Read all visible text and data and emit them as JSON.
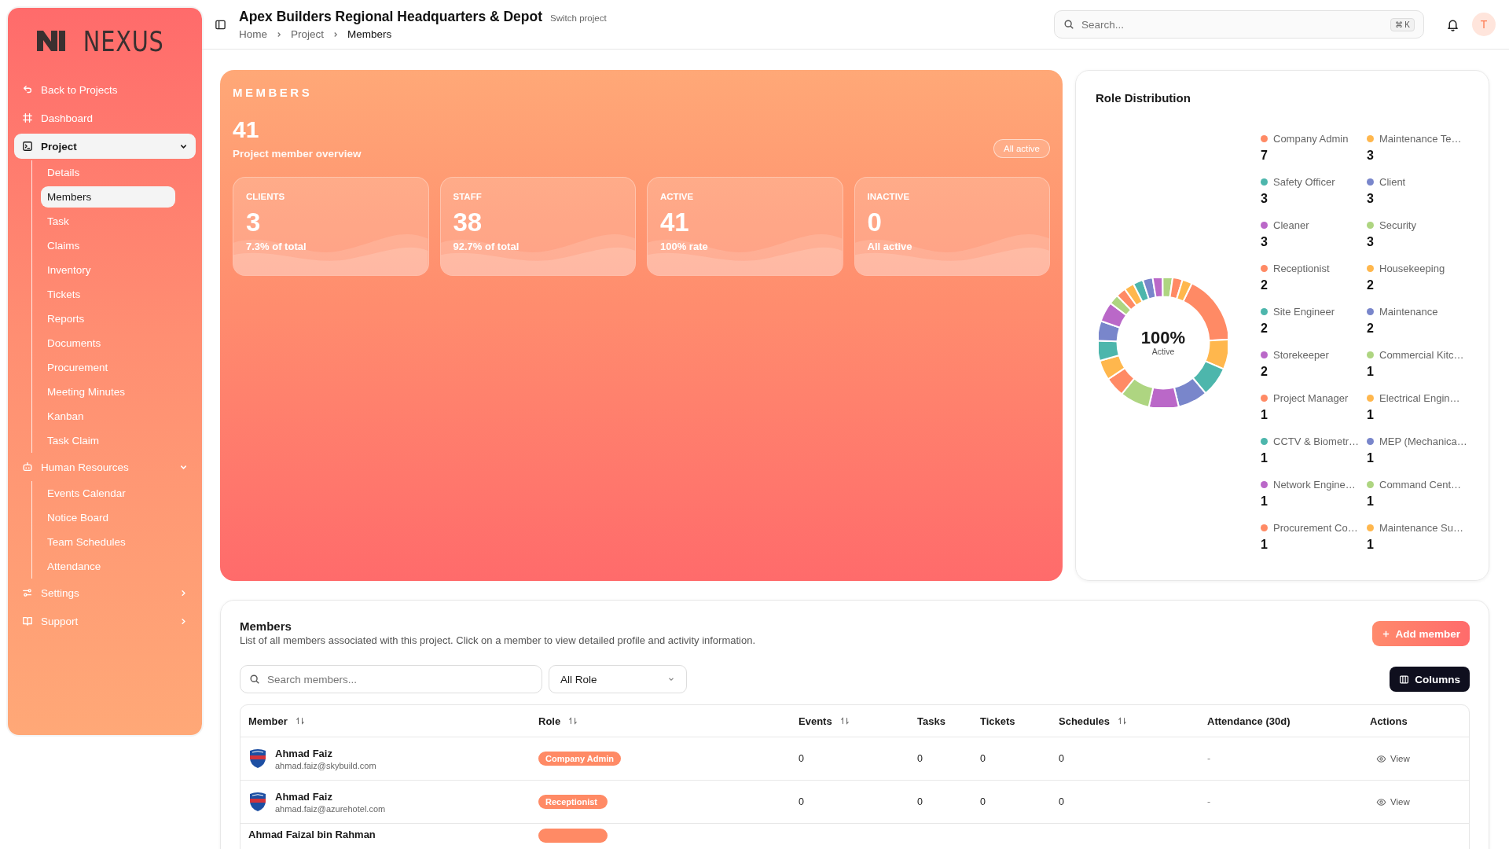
{
  "sidebar": {
    "logo": "NEXUS",
    "items": [
      {
        "label": "Back to Projects",
        "kind": "link",
        "selected": false
      },
      {
        "label": "Dashboard",
        "kind": "link",
        "selected": false
      },
      {
        "label": "Project",
        "kind": "group",
        "selected": true,
        "expanded": true,
        "children": [
          {
            "label": "Details",
            "selected": false
          },
          {
            "label": "Members",
            "selected": true
          },
          {
            "label": "Task",
            "selected": false
          },
          {
            "label": "Claims",
            "selected": false
          },
          {
            "label": "Inventory",
            "selected": false
          },
          {
            "label": "Tickets",
            "selected": false
          },
          {
            "label": "Reports",
            "selected": false
          },
          {
            "label": "Documents",
            "selected": false
          },
          {
            "label": "Procurement",
            "selected": false
          },
          {
            "label": "Meeting Minutes",
            "selected": false
          },
          {
            "label": "Kanban",
            "selected": false
          },
          {
            "label": "Task Claim",
            "selected": false
          }
        ]
      },
      {
        "label": "Human Resources",
        "kind": "group",
        "selected": false,
        "expanded": true,
        "children": [
          {
            "label": "Events Calendar",
            "selected": false
          },
          {
            "label": "Notice Board",
            "selected": false
          },
          {
            "label": "Team Schedules",
            "selected": false
          },
          {
            "label": "Attendance",
            "selected": false
          }
        ]
      },
      {
        "label": "Settings",
        "kind": "group",
        "selected": false,
        "expanded": false
      },
      {
        "label": "Support",
        "kind": "group",
        "selected": false,
        "expanded": false
      }
    ]
  },
  "header": {
    "title": "Apex Builders Regional Headquarters & Depot",
    "switch_label": "Switch project",
    "breadcrumbs": [
      {
        "label": "Home",
        "current": false
      },
      {
        "label": "Project",
        "current": false
      },
      {
        "label": "Members",
        "current": true
      }
    ],
    "search": {
      "placeholder": "Search...",
      "shortcut": "⌘ K"
    },
    "avatar": "T"
  },
  "overview": {
    "title": "MEMBERS",
    "total": "41",
    "subtitle": "Project member overview",
    "status_pill": "All active",
    "tiles": [
      {
        "label": "CLIENTS",
        "value": "3",
        "note": "7.3% of total"
      },
      {
        "label": "STAFF",
        "value": "38",
        "note": "92.7% of total"
      },
      {
        "label": "ACTIVE",
        "value": "41",
        "note": "100% rate"
      },
      {
        "label": "INACTIVE",
        "value": "0",
        "note": "All active"
      }
    ]
  },
  "role_distribution": {
    "title": "Role Distribution",
    "center_value": "100%",
    "center_label": "Active",
    "legend": [
      {
        "count": "7",
        "color": "#ff8a65"
      },
      {
        "count": "3",
        "color": "#ffb74d"
      },
      {
        "count": "3",
        "color": "#4db6ac"
      },
      {
        "count": "3",
        "color": "#7986cb"
      },
      {
        "count": "3",
        "color": "#ba68c8"
      },
      {
        "count": "3",
        "color": "#aed581"
      },
      {
        "count": "2",
        "color": "#ff8a65"
      },
      {
        "count": "2",
        "color": "#ffb74d"
      },
      {
        "count": "2",
        "color": "#4db6ac"
      },
      {
        "count": "2",
        "color": "#7986cb"
      },
      {
        "count": "2",
        "color": "#ba68c8"
      },
      {
        "count": "1",
        "color": "#aed581"
      },
      {
        "count": "1",
        "color": "#ff8a65"
      },
      {
        "count": "1",
        "color": "#ffb74d"
      },
      {
        "count": "1",
        "color": "#4db6ac"
      },
      {
        "count": "1",
        "color": "#7986cb"
      },
      {
        "count": "1",
        "color": "#ba68c8"
      },
      {
        "count": "1",
        "color": "#aed581"
      },
      {
        "count": "1",
        "color": "#ff8a65"
      },
      {
        "count": "1",
        "color": "#ffb74d"
      }
    ],
    "chart_data": {
      "type": "donut",
      "categories": [
        "Company Admin",
        "Maintenance Te…",
        "Safety Officer",
        "Client",
        "Cleaner",
        "Security",
        "Receptionist",
        "Housekeeping",
        "Site Engineer",
        "Maintenance",
        "Storekeeper",
        "Commercial Kitc…",
        "Project Manager",
        "Electrical Engin…",
        "CCTV & Biometr…",
        "MEP (Mechanica…",
        "Network Engine…",
        "Command Cent…",
        "Procurement Co…",
        "Maintenance Su…"
      ],
      "values": [
        17.07,
        7.32,
        7.32,
        7.32,
        7.32,
        7.32,
        4.88,
        4.88,
        4.88,
        4.88,
        4.88,
        2.44,
        2.44,
        2.44,
        2.44,
        2.44,
        2.44,
        2.44,
        2.44,
        2.41
      ]
    }
  },
  "members": {
    "title": "Members",
    "description": "List of all members associated with this project. Click on a member to view detailed profile and activity information.",
    "add_button": "Add member",
    "search": {
      "placeholder": "Search members..."
    },
    "role_filter": {
      "value": "All Role"
    },
    "columns_button": "Columns",
    "table": {
      "columns": [
        {
          "label": "Member",
          "sortable": true
        },
        {
          "label": "Role",
          "sortable": true
        },
        {
          "label": "Events",
          "sortable": true
        },
        {
          "label": "Tasks",
          "sortable": false
        },
        {
          "label": "Tickets",
          "sortable": false
        },
        {
          "label": "Schedules",
          "sortable": true
        },
        {
          "label": "Attendance (30d)",
          "sortable": false
        },
        {
          "label": "Actions",
          "sortable": false
        }
      ],
      "rows": [
        {
          "name": "Ahmad Faiz",
          "email": "ahmad.faiz@skybuild.com",
          "role": "Company Admin",
          "events": "0",
          "tasks": "0",
          "tickets": "0",
          "schedules": "0",
          "attendance": "-",
          "action": "View"
        },
        {
          "name": "Ahmad Faiz",
          "email": "ahmad.faiz@azurehotel.com",
          "role": "Receptionist",
          "events": "0",
          "tasks": "0",
          "tickets": "0",
          "schedules": "0",
          "attendance": "-",
          "action": "View"
        },
        {
          "name": "Ahmad Faizal bin Rahman"
        }
      ]
    }
  }
}
